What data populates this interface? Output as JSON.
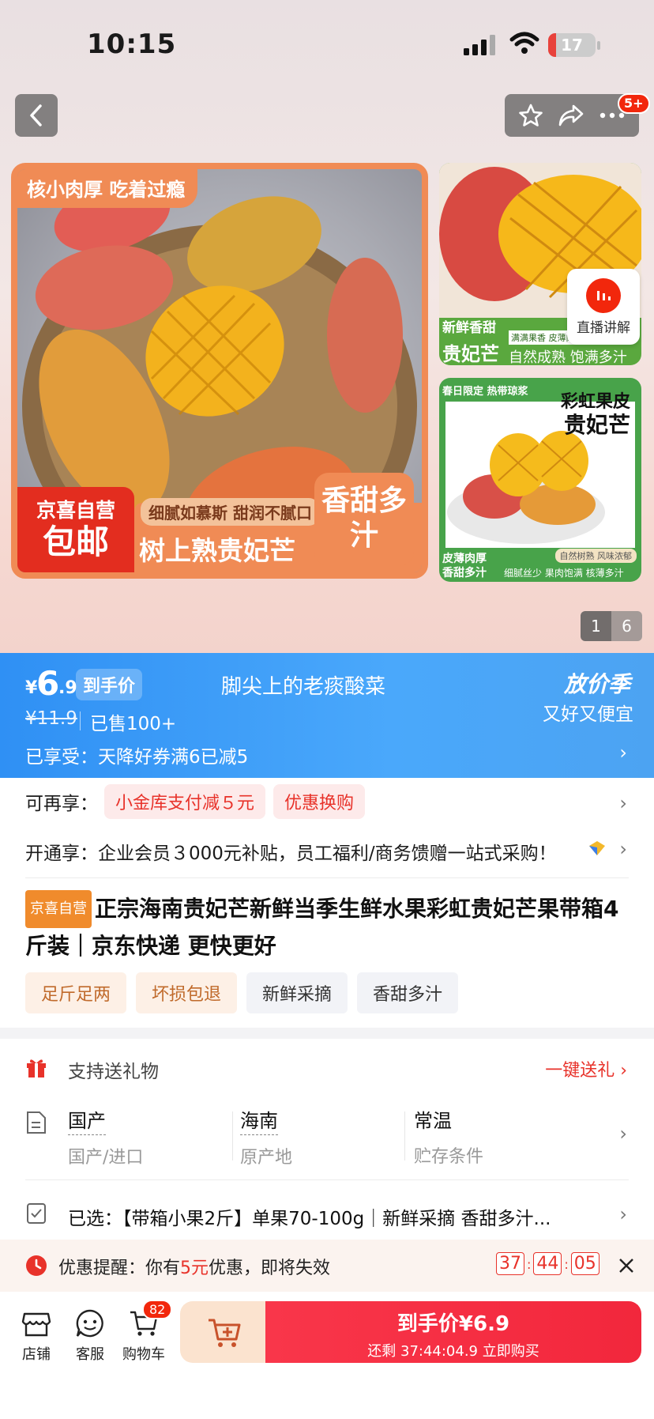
{
  "status": {
    "time": "10:15",
    "battery": "17",
    "battery_level": 0.17
  },
  "top": {
    "more_badge": "5+"
  },
  "gallery": {
    "main_tag": "核小肉厚 吃着过瘾",
    "jx_line1": "京喜自营",
    "jx_line2": "包邮",
    "pill": "细腻如慕斯 甜润不腻口",
    "headline": "树上熟贵妃芒",
    "sweet": "香甜多汁",
    "side1_a": "新鲜香甜",
    "side1_b": "贵妃芒",
    "side1_c": "满满果香 皮薄肉",
    "side1_d": "自然成熟 饱满多汁",
    "side2_top": "春日限定 热带琼浆",
    "side2_title1": "彩虹果皮",
    "side2_title2": "贵妃芒",
    "side2_note": "自然树熟 风味浓郁",
    "side2_b1": "皮薄肉厚",
    "side2_b2": "香甜多汁",
    "side2_b3": "细腻丝少 果肉饱满 核薄多汁",
    "live_label": "直播讲解",
    "pager_current": "1",
    "pager_total": "6"
  },
  "price": {
    "yen": "¥",
    "int": "6",
    "dec": ".9",
    "tag": "到手价",
    "slogan": "脚尖上的老痰酸菜",
    "event": "放价季",
    "event_sub": "又好又便宜",
    "old": "¥11.9",
    "sold": "已售100+",
    "enjoyed": "已享受：天降好券满6已减5"
  },
  "promo": {
    "label": "可再享：",
    "chip1": "小金库支付减５元",
    "chip2": "优惠换购",
    "member": "开通享：企业会员３000元补贴，员工福利/商务馈赠一站式采购！"
  },
  "product": {
    "shop_tag": "京喜自营",
    "title": "正宗海南贵妃芒新鲜当季生鲜水果彩虹贵妃芒果带箱4斤装｜京东快递 更快更好",
    "tags": [
      "足斤足两",
      "坏损包退",
      "新鲜采摘",
      "香甜多汁"
    ]
  },
  "gift": {
    "label": "支持送礼物",
    "action": "一键送礼"
  },
  "spec": {
    "origin_type": "国产",
    "origin_type_label": "国产/进口",
    "origin": "海南",
    "origin_label": "原产地",
    "storage": "常温",
    "storage_label": "贮存条件"
  },
  "selected": {
    "label": "已选：",
    "value": "【带箱小果2斤】单果70-100g｜新鲜采摘 香甜多汁..."
  },
  "notice": {
    "prefix": "优惠提醒：你有",
    "amount": "5元",
    "suffix": "优惠，即将失效",
    "h": "37",
    "m": "44",
    "s": "05"
  },
  "bottom": {
    "shop": "店铺",
    "service": "客服",
    "cart": "购物车",
    "cart_count": "82",
    "buy_label": "到手价¥6.9",
    "buy_sub": "还剩 37:44:04.9 立即购买"
  },
  "colors": {
    "brand_red": "#f2270c",
    "price_blue": "#3c9cf7",
    "accent_orange": "#f08b55"
  }
}
